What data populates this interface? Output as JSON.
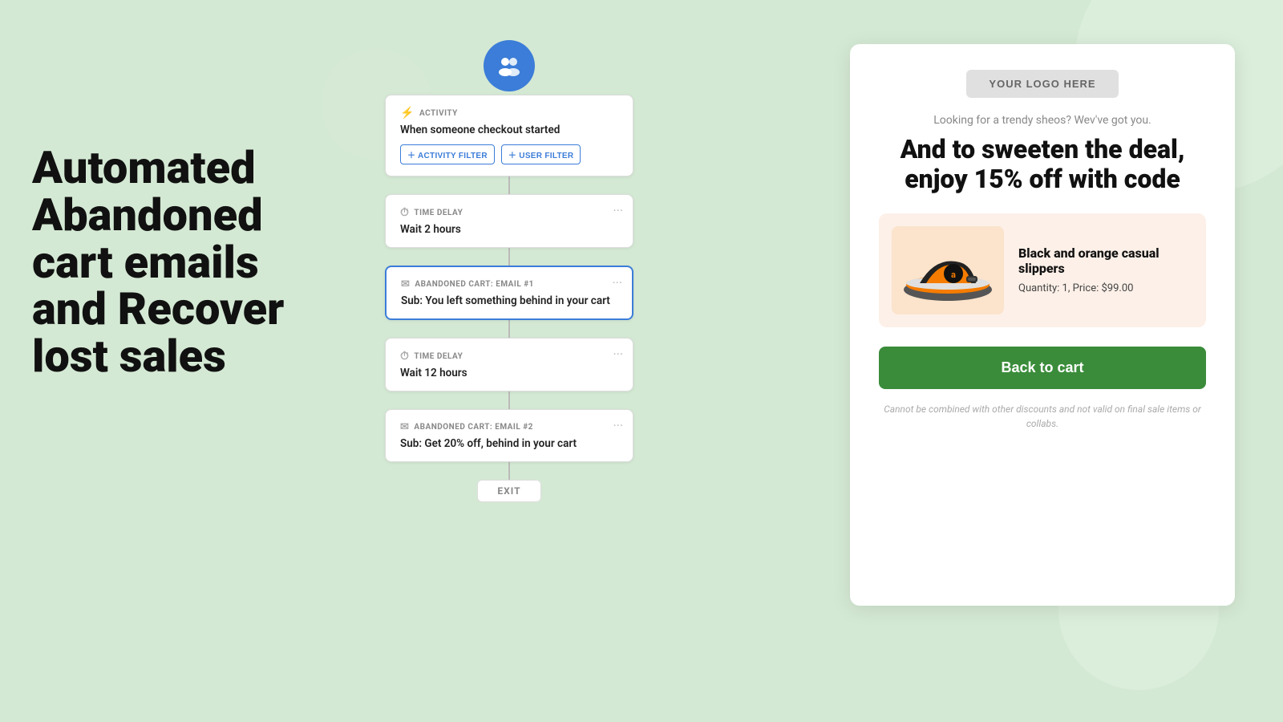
{
  "background": {
    "color": "#d4e9d4"
  },
  "left": {
    "headline": "Automated Abandoned cart emails and Recover lost sales"
  },
  "workflow": {
    "avatar_icon": "👥",
    "steps": [
      {
        "id": "activity",
        "type": "ACTIVITY",
        "icon_type": "bolt",
        "label": "ACTIVITY",
        "text": "When someone checkout started",
        "filters": [
          {
            "label": "＋ ACTIVITY FILTER"
          },
          {
            "label": "＋ USER FILTER"
          }
        ],
        "has_dots": false,
        "highlighted": false
      },
      {
        "id": "delay1",
        "type": "TIME_DELAY",
        "icon_type": "clock",
        "label": "TIME DELAY",
        "text": "Wait 2 hours",
        "has_dots": true,
        "highlighted": false
      },
      {
        "id": "email1",
        "type": "EMAIL",
        "icon_type": "email",
        "label": "ABANDONED CART: EMAIL #1",
        "text": "Sub: You left something behind in your cart",
        "has_dots": true,
        "highlighted": true
      },
      {
        "id": "delay2",
        "type": "TIME_DELAY",
        "icon_type": "clock",
        "label": "TIME DELAY",
        "text": "Wait 12 hours",
        "has_dots": true,
        "highlighted": false
      },
      {
        "id": "email2",
        "type": "EMAIL",
        "icon_type": "email",
        "label": "ABANDONED CART: EMAIL #2",
        "text": "Sub: Get 20% off, behind in your cart",
        "has_dots": true,
        "highlighted": false
      }
    ],
    "exit_label": "EXIT"
  },
  "email_preview": {
    "logo_label": "YOUR LOGO HERE",
    "tagline": "Looking for a trendy sheos? Wev've got you.",
    "headline": "And to sweeten the deal, enjoy 15% off with code",
    "product": {
      "name": "Black and orange casual slippers",
      "quantity": 1,
      "price": "$99.00",
      "meta": "Quantity: 1, Price: $99.00"
    },
    "cta_label": "Back to cart",
    "disclaimer": "Cannot be combined with other discounts and not valid on final sale items or collabs."
  }
}
